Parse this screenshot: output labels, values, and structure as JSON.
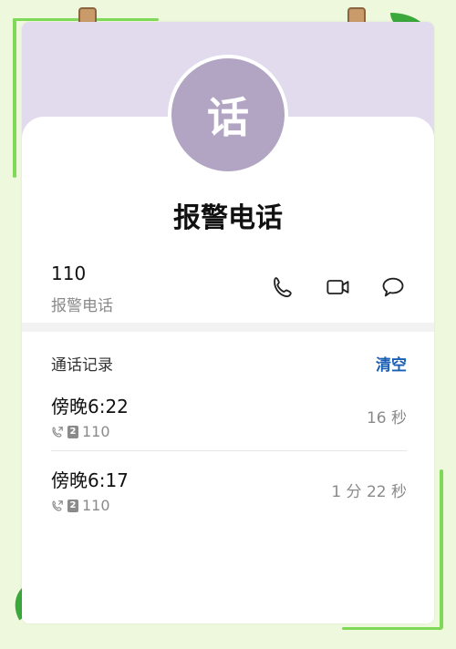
{
  "contact": {
    "avatar_char": "话",
    "name": "报警电话",
    "number": "110",
    "label": "报警电话"
  },
  "actions": [
    {
      "icon": "phone-icon"
    },
    {
      "icon": "video-icon"
    },
    {
      "icon": "message-icon"
    }
  ],
  "records": {
    "title": "通话记录",
    "clear_label": "清空",
    "items": [
      {
        "time": "傍晚6:22",
        "sim": "2",
        "number": "110",
        "duration": "16 秒"
      },
      {
        "time": "傍晚6:17",
        "sim": "2",
        "number": "110",
        "duration": "1 分 22 秒"
      }
    ]
  },
  "colors": {
    "header_bg": "#e2dbee",
    "avatar_bg": "#b2a5c3",
    "accent": "#1a5fb4",
    "page_bg": "#eef8dc"
  }
}
